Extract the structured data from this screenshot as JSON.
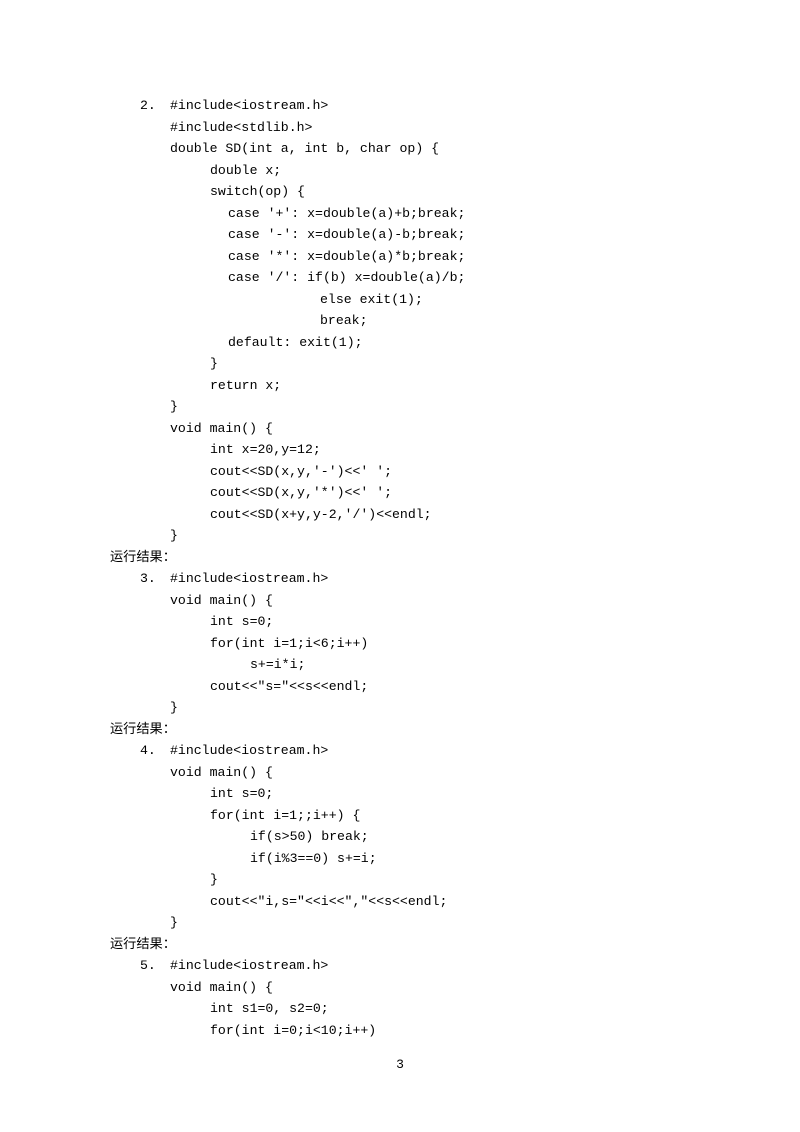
{
  "items": [
    {
      "num": "2.",
      "lines": [
        {
          "cls": "indent-1",
          "t": "#include<iostream.h>"
        },
        {
          "cls": "indent-1",
          "t": "#include<stdlib.h>"
        },
        {
          "cls": "indent-1",
          "t": "double SD(int a, int b, char op) {"
        },
        {
          "cls": "indent-2",
          "t": "double x;"
        },
        {
          "cls": "indent-2",
          "t": "switch(op) {"
        },
        {
          "cls": "indent-3",
          "t": "case '+': x=double(a)+b;break;"
        },
        {
          "cls": "indent-3",
          "t": "case '-': x=double(a)-b;break;"
        },
        {
          "cls": "indent-3",
          "t": "case '*': x=double(a)*b;break;"
        },
        {
          "cls": "indent-3",
          "t": "case '/': if(b) x=double(a)/b;"
        },
        {
          "cls": "indent-extra",
          "t": "else exit(1);"
        },
        {
          "cls": "indent-extra",
          "t": "break;"
        },
        {
          "cls": "indent-3",
          "t": "default: exit(1);"
        },
        {
          "cls": "indent-2",
          "t": "}"
        },
        {
          "cls": "indent-2",
          "t": "return x;"
        },
        {
          "cls": "indent-1",
          "t": "}"
        },
        {
          "cls": "indent-1",
          "t": "void main() {"
        },
        {
          "cls": "indent-2",
          "t": "int x=20,y=12;"
        },
        {
          "cls": "indent-2",
          "t": "cout<<SD(x,y,'-')<<' ';"
        },
        {
          "cls": "indent-2",
          "t": "cout<<SD(x,y,'*')<<' ';"
        },
        {
          "cls": "indent-2",
          "t": "cout<<SD(x+y,y-2,'/')<<endl;"
        },
        {
          "cls": "indent-1",
          "t": "}"
        }
      ],
      "result": "运行结果："
    },
    {
      "num": "3.",
      "lines": [
        {
          "cls": "indent-1",
          "t": "#include<iostream.h>"
        },
        {
          "cls": "indent-1",
          "t": "void main() {"
        },
        {
          "cls": "indent-2",
          "t": "int s=0;"
        },
        {
          "cls": "indent-2",
          "t": "for(int i=1;i<6;i++)"
        },
        {
          "cls": "indent-4",
          "t": "s+=i*i;"
        },
        {
          "cls": "indent-2",
          "t": "cout<<\"s=\"<<s<<endl;"
        },
        {
          "cls": "indent-1",
          "t": "}"
        }
      ],
      "result": "运行结果："
    },
    {
      "num": "4.",
      "lines": [
        {
          "cls": "indent-1",
          "t": "#include<iostream.h>"
        },
        {
          "cls": "indent-1",
          "t": "void main() {"
        },
        {
          "cls": "indent-2",
          "t": "int s=0;"
        },
        {
          "cls": "indent-2",
          "t": "for(int i=1;;i++) {"
        },
        {
          "cls": "indent-4",
          "t": "if(s>50) break;"
        },
        {
          "cls": "indent-4",
          "t": "if(i%3==0) s+=i;"
        },
        {
          "cls": "indent-2",
          "t": "}"
        },
        {
          "cls": "indent-2",
          "t": "cout<<\"i,s=\"<<i<<\",\"<<s<<endl;"
        },
        {
          "cls": "indent-1",
          "t": "}"
        }
      ],
      "result": "运行结果："
    },
    {
      "num": "5.",
      "lines": [
        {
          "cls": "indent-1",
          "t": "#include<iostream.h>"
        },
        {
          "cls": "indent-1",
          "t": "void main() {"
        },
        {
          "cls": "indent-2",
          "t": "int s1=0, s2=0;"
        },
        {
          "cls": "indent-2",
          "t": "for(int i=0;i<10;i++)"
        }
      ],
      "result": null
    }
  ],
  "page_number": "3"
}
